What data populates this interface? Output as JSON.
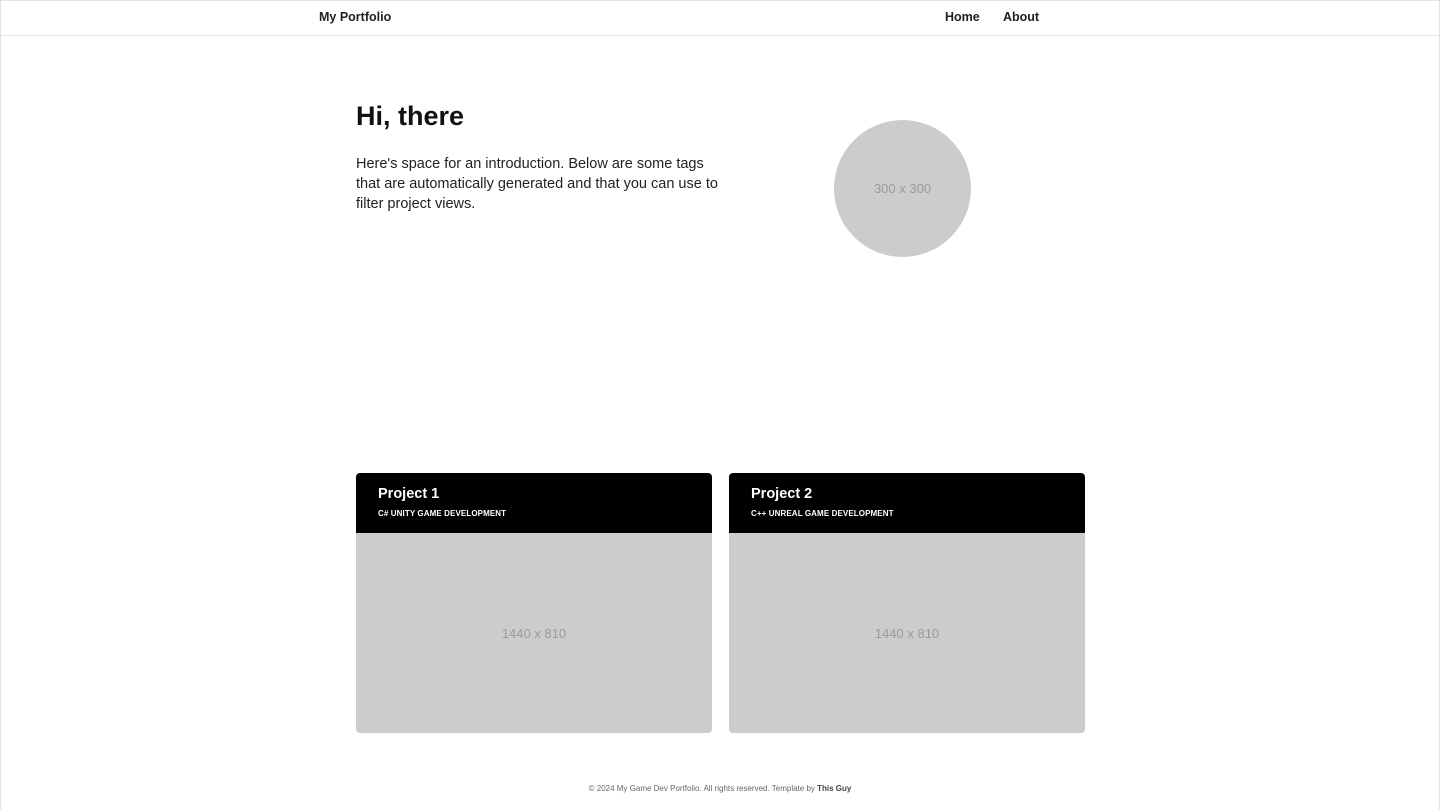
{
  "navbar": {
    "brand": "My Portfolio",
    "links": [
      "Home",
      "About"
    ]
  },
  "hero": {
    "title": "Hi, there",
    "intro": "Here's space for an introduction. Below are some tags that are automatically generated and that you can use to filter project views.",
    "avatar_placeholder": "300 x 300"
  },
  "projects": [
    {
      "title": "Project 1",
      "tags": "C# UNITY GAME DEVELOPMENT",
      "image_placeholder": "1440 x 810"
    },
    {
      "title": "Project 2",
      "tags": "C++ UNREAL GAME DEVELOPMENT",
      "image_placeholder": "1440 x 810"
    }
  ],
  "footer": {
    "text": "© 2024 My Game Dev Portfolio. All rights reserved. Template by",
    "author": "This Guy"
  },
  "colors": {
    "placeholder_gray": "#cccccc",
    "card_header": "#000000",
    "background": "#ffffff"
  }
}
